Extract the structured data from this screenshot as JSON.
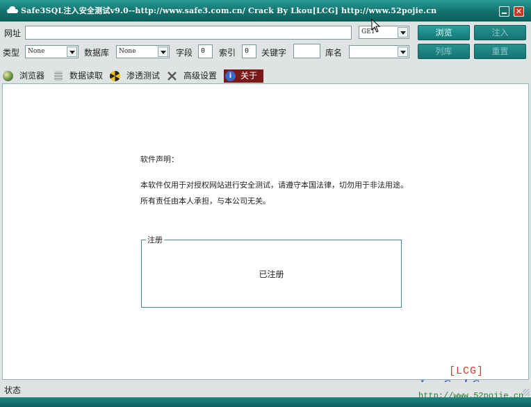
{
  "window": {
    "title": "Safe3SQL注入安全测试v9.0--http://www.safe3.com.cn/  Crack By Lkou[LCG]  http://www.52pojie.cn"
  },
  "toolbar": {
    "url_label": "网址",
    "url_value": "",
    "method_value": "GET",
    "browse_button": "浏览",
    "inject_button": "注入",
    "type_label": "类型",
    "type_value": "None",
    "db_label": "数据库",
    "db_value": "None",
    "field_label": "字段",
    "field_value": "0",
    "index_label": "索引",
    "index_value": "0",
    "keyword_label": "关键字",
    "keyword_value": "",
    "dbname_label": "库名",
    "dbname_value": "",
    "list_db_button": "列库",
    "reset_button": "重置"
  },
  "tabs": [
    {
      "label": "浏览器",
      "icon": "globe-icon"
    },
    {
      "label": "数据读取",
      "icon": "database-icon"
    },
    {
      "label": "渗透测试",
      "icon": "radiation-icon"
    },
    {
      "label": "高级设置",
      "icon": "tools-icon"
    },
    {
      "label": "关于",
      "icon": "info-icon",
      "active": true
    }
  ],
  "about": {
    "heading": "软件声明：",
    "line1": "本软件仅用于对授权网站进行安全测试，请遵守本国法律，切勿用于非法用途。",
    "line2": "所有责任由本人承担，与本公司无关。",
    "group_title": "注册",
    "registered": "已注册"
  },
  "status": {
    "label": "状态"
  },
  "watermark": {
    "tag": "[LCG]",
    "name": "Love Crack Group",
    "url": "http://www.52pojie.cn"
  },
  "colors": {
    "title_bar": "#12706d",
    "button": "#1f8c89",
    "active_tab": "#7a1a18",
    "close_button": "#c43a22"
  }
}
